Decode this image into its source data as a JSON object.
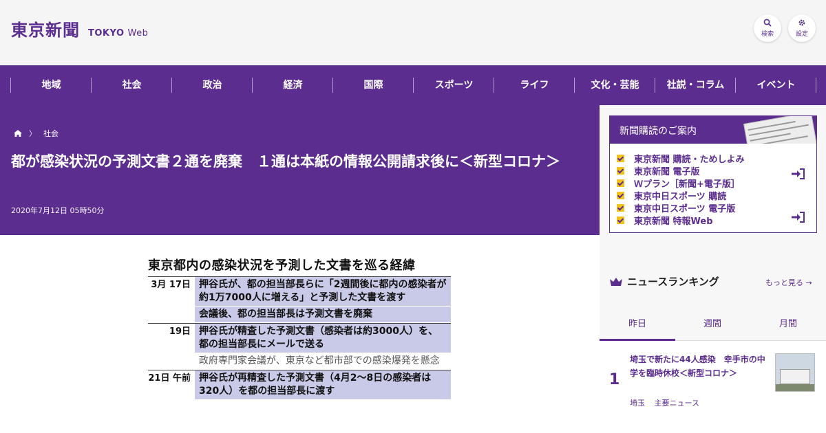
{
  "header": {
    "logo_jp": "東京新聞",
    "logo_en": "TOKYO",
    "logo_web": "Web",
    "search_label": "検索",
    "settings_label": "設定",
    "search_icon": "search-icon",
    "settings_icon": "gear-icon"
  },
  "nav": {
    "items": [
      {
        "label": "地域"
      },
      {
        "label": "社会"
      },
      {
        "label": "政治"
      },
      {
        "label": "経済"
      },
      {
        "label": "国際"
      },
      {
        "label": "スポーツ"
      },
      {
        "label": "ライフ"
      },
      {
        "label": "文化・芸能"
      },
      {
        "label": "社説・コラム"
      },
      {
        "label": "イベント"
      }
    ]
  },
  "article": {
    "breadcrumb_category": "社会",
    "title": "都が感染状況の予測文書２通を廃棄　１通は本紙の情報公開請求後に＜新型コロナ＞",
    "date": "2020年7月12日 05時50分"
  },
  "figure": {
    "title": "東京都内の感染状況を予測した文書を巡る経緯",
    "rows": [
      {
        "date": "3月 17日",
        "cells": [
          {
            "text": "押谷氏が、都の担当部長らに「2週間後に都内の感染者が約1万7000人に増える」と予測した文書を渡す",
            "style": "key"
          },
          {
            "text": "会議後、都の担当部長は予測文書を廃棄",
            "style": "key"
          }
        ]
      },
      {
        "date": "19日",
        "cells": [
          {
            "text": "押谷氏が精査した予測文書（感染者は約3000人）を、都の担当部長にメールで送る",
            "style": "key"
          },
          {
            "text": "政府専門家会議が、東京など都市部での感染爆発を懸念",
            "style": "plain"
          }
        ]
      },
      {
        "date": "21日 午前",
        "cells": [
          {
            "text": "押谷氏が再精査した予測文書（4月2～8日の感染者は320人）を都の担当部長に渡す",
            "style": "key"
          }
        ]
      }
    ]
  },
  "sidebar": {
    "subscription": {
      "title": "新聞購読のご案内",
      "items": [
        {
          "label": "東京新聞 購読・ためしよみ"
        },
        {
          "label": "東京新聞 電子版"
        },
        {
          "label": "Ｗプラン［新聞+電子版］"
        },
        {
          "label": "東京中日スポーツ 購読"
        },
        {
          "label": "東京中日スポーツ 電子版"
        },
        {
          "label": "東京新聞 特報Web"
        }
      ]
    },
    "ranking": {
      "title": "ニュースランキング",
      "more": "もっと見る",
      "tabs": [
        {
          "label": "昨日"
        },
        {
          "label": "週間"
        },
        {
          "label": "月間"
        }
      ],
      "item": {
        "rank": "1",
        "headline": "埼玉で新たに44人感染　幸手市の中学を臨時休校＜新型コロナ＞",
        "tag1": "埼玉",
        "tag2": "主要ニュース"
      }
    }
  },
  "colors": {
    "brand": "#5b2d8e",
    "figure_highlight": "#c9c9e8",
    "check": "#f2c21a"
  }
}
